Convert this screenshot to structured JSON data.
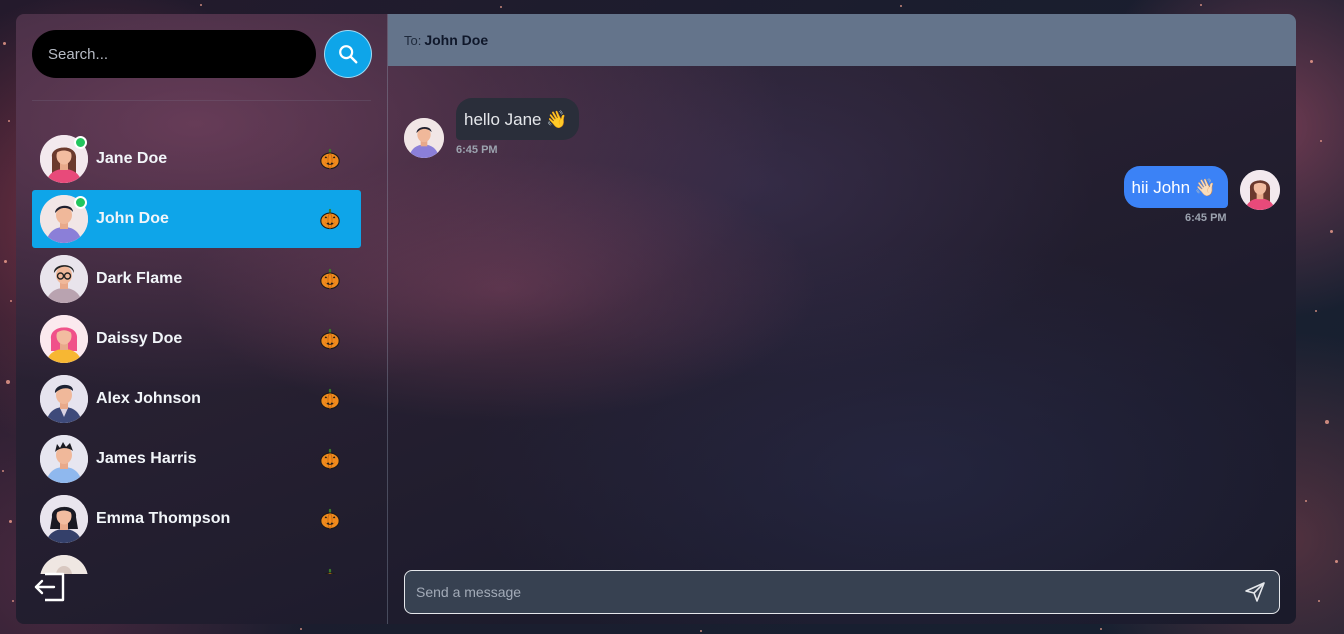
{
  "search": {
    "placeholder": "Search..."
  },
  "contacts": [
    {
      "name": "Jane Doe",
      "online": true,
      "active": false,
      "avatar": "woman-brown-hair-pink-top"
    },
    {
      "name": "John Doe",
      "online": true,
      "active": true,
      "avatar": "man-dark-hair-purple-top"
    },
    {
      "name": "Dark Flame",
      "online": false,
      "active": false,
      "avatar": "man-glasses-curly-hair"
    },
    {
      "name": "Daissy Doe",
      "online": false,
      "active": false,
      "avatar": "woman-pink-hair-yellow-top"
    },
    {
      "name": "Alex Johnson",
      "online": false,
      "active": false,
      "avatar": "man-jacket-dark-hair"
    },
    {
      "name": "James Harris",
      "online": false,
      "active": false,
      "avatar": "man-blue-shirt-spiky-hair"
    },
    {
      "name": "Emma Thompson",
      "online": false,
      "active": false,
      "avatar": "woman-dark-hair-navy-top"
    }
  ],
  "contact_badge_icon": "jack-o-lantern-icon",
  "header": {
    "to_label": "To:",
    "to_name": "John Doe"
  },
  "messages": [
    {
      "direction": "in",
      "text": "hello Jane 👋",
      "time": "6:45 PM"
    },
    {
      "direction": "out",
      "text": "hii John 👋🏻",
      "time": "6:45 PM"
    }
  ],
  "composer": {
    "placeholder": "Send a message"
  },
  "colors": {
    "accent": "#0ea5e9",
    "outgoing_bubble": "#3b82f6",
    "incoming_bubble": "#2a2e3a",
    "header": "#64748b",
    "online": "#22c55e"
  }
}
